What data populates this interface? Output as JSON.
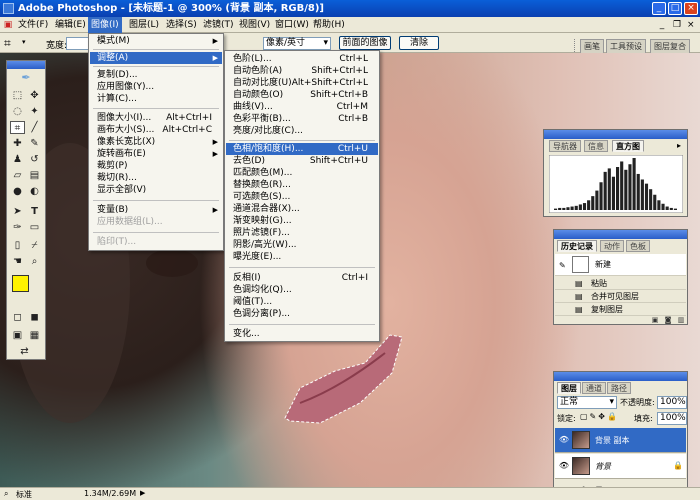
{
  "titlebar": {
    "title": "Adobe Photoshop - [未标题-1 @ 300% (背景 副本, RGB/8)]",
    "minimize": "_",
    "maximize": "□",
    "close": "×"
  },
  "menubar": [
    "文件(F)",
    "编辑(E)",
    "图像(I)",
    "图层(L)",
    "选择(S)",
    "滤镜(T)",
    "视图(V)",
    "窗口(W)",
    "帮助(H)"
  ],
  "options": {
    "width_label": "宽度:",
    "unit": "像素/英寸",
    "front_image": "前面的图像",
    "clear": "清除",
    "tabs": [
      "画笔",
      "工具预设",
      "图层复合"
    ]
  },
  "image_menu": [
    {
      "label": "模式(M)",
      "arrow": "▶"
    },
    {
      "label": "调整(A)",
      "arrow": "▶",
      "highlight": true
    },
    {
      "label": "复制(D)..."
    },
    {
      "label": "应用图像(Y)..."
    },
    {
      "label": "计算(C)..."
    },
    {
      "label": "图像大小(I)...",
      "shortcut": "Alt+Ctrl+I"
    },
    {
      "label": "画布大小(S)...",
      "shortcut": "Alt+Ctrl+C"
    },
    {
      "label": "像素长宽比(X)",
      "arrow": "▶"
    },
    {
      "label": "旋转画布(E)",
      "arrow": "▶"
    },
    {
      "label": "裁剪(P)"
    },
    {
      "label": "裁切(R)..."
    },
    {
      "label": "显示全部(V)"
    },
    {
      "label": "变量(B)",
      "arrow": "▶"
    },
    {
      "label": "应用数据组(L)...",
      "disabled": true
    },
    {
      "label": "陷印(T)...",
      "disabled": true
    }
  ],
  "adjust_menu": [
    {
      "label": "色阶(L)...",
      "shortcut": "Ctrl+L"
    },
    {
      "label": "自动色阶(A)",
      "shortcut": "Shift+Ctrl+L"
    },
    {
      "label": "自动对比度(U)",
      "shortcut": "Alt+Shift+Ctrl+L"
    },
    {
      "label": "自动颜色(O)",
      "shortcut": "Shift+Ctrl+B"
    },
    {
      "label": "曲线(V)...",
      "shortcut": "Ctrl+M"
    },
    {
      "label": "色彩平衡(B)...",
      "shortcut": "Ctrl+B"
    },
    {
      "label": "亮度/对比度(C)..."
    },
    {
      "label": "色相/饱和度(H)...",
      "shortcut": "Ctrl+U",
      "highlight": true
    },
    {
      "label": "去色(D)",
      "shortcut": "Shift+Ctrl+U"
    },
    {
      "label": "匹配颜色(M)..."
    },
    {
      "label": "替换颜色(R)..."
    },
    {
      "label": "可选颜色(S)..."
    },
    {
      "label": "通道混合器(X)..."
    },
    {
      "label": "渐变映射(G)..."
    },
    {
      "label": "照片滤镜(F)..."
    },
    {
      "label": "阴影/高光(W)..."
    },
    {
      "label": "曝光度(E)..."
    },
    {
      "label": "反相(I)",
      "shortcut": "Ctrl+I"
    },
    {
      "label": "色调均化(Q)..."
    },
    {
      "label": "阈值(T)..."
    },
    {
      "label": "色调分离(P)..."
    },
    {
      "label": "变化..."
    }
  ],
  "navigator_tabs": [
    "导航器",
    "信息",
    "直方图"
  ],
  "histogram": [
    2,
    3,
    3,
    4,
    5,
    6,
    8,
    10,
    14,
    20,
    28,
    40,
    55,
    60,
    48,
    62,
    70,
    58,
    66,
    75,
    52,
    44,
    38,
    30,
    22,
    14,
    9,
    5,
    3,
    2
  ],
  "history": {
    "tabs": [
      "历史记录",
      "动作",
      "色板"
    ],
    "snapshot": "新建",
    "items": [
      "粘贴",
      "合并可见图层",
      "复制图层"
    ]
  },
  "layers": {
    "tabs": [
      "图层",
      "通道",
      "路径"
    ],
    "blend": "正常",
    "opacity_label": "不透明度:",
    "opacity": "100%",
    "lock_label": "锁定:",
    "fill_label": "填充:",
    "fill": "100%",
    "items": [
      {
        "name": "背景 副本",
        "selected": true
      },
      {
        "name": "背景",
        "locked": true
      }
    ]
  },
  "status": {
    "mode": "标准",
    "doc": "1.34M/2.69M",
    "arrow": "▶"
  },
  "colors": {
    "fg": "#fff200",
    "bg": "#ffffff",
    "highlight": "#316ac5"
  }
}
